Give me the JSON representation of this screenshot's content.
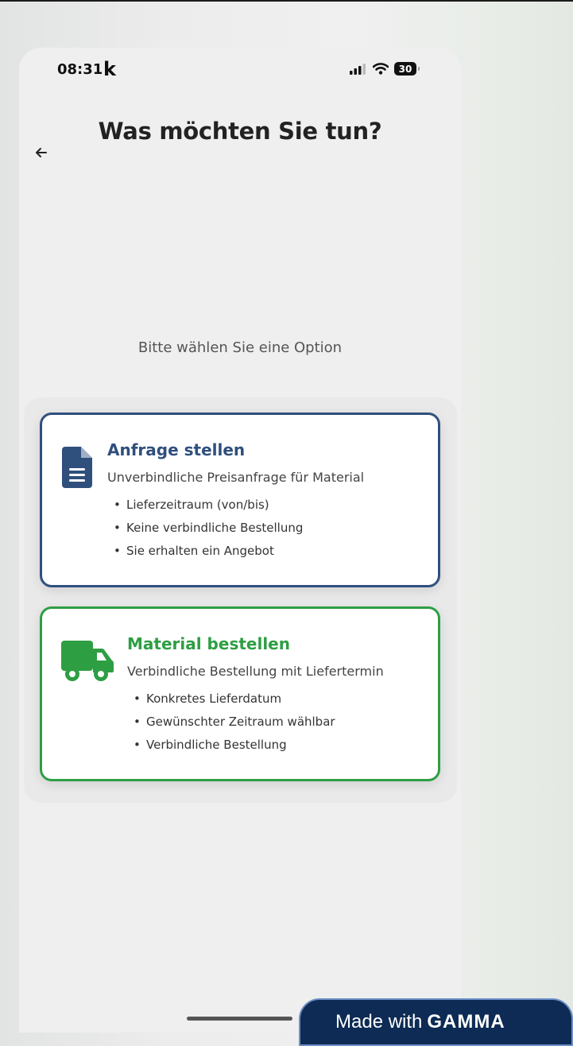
{
  "status_bar": {
    "time": "08:31",
    "app_letter": "k",
    "battery": "30"
  },
  "header": {
    "title": "Was möchten Sie tun?"
  },
  "prompt": "Bitte wählen Sie eine Option",
  "options": [
    {
      "title": "Anfrage stellen",
      "subtitle": "Unverbindliche Preisanfrage für Material",
      "bullets": [
        "Lieferzeitraum (von/bis)",
        "Keine verbindliche Bestellung",
        "Sie erhalten ein Angebot"
      ],
      "icon": "document-icon",
      "color": "#2f4f7d"
    },
    {
      "title": "Material bestellen",
      "subtitle": "Verbindliche Bestellung mit Liefertermin",
      "bullets": [
        "Konkretes Lieferdatum",
        "Gewünschter Zeitraum wählbar",
        "Verbindliche Bestellung"
      ],
      "icon": "truck-icon",
      "color": "#2e9e43"
    }
  ],
  "badge": {
    "prefix": "Made with",
    "brand": "GAMMA"
  }
}
